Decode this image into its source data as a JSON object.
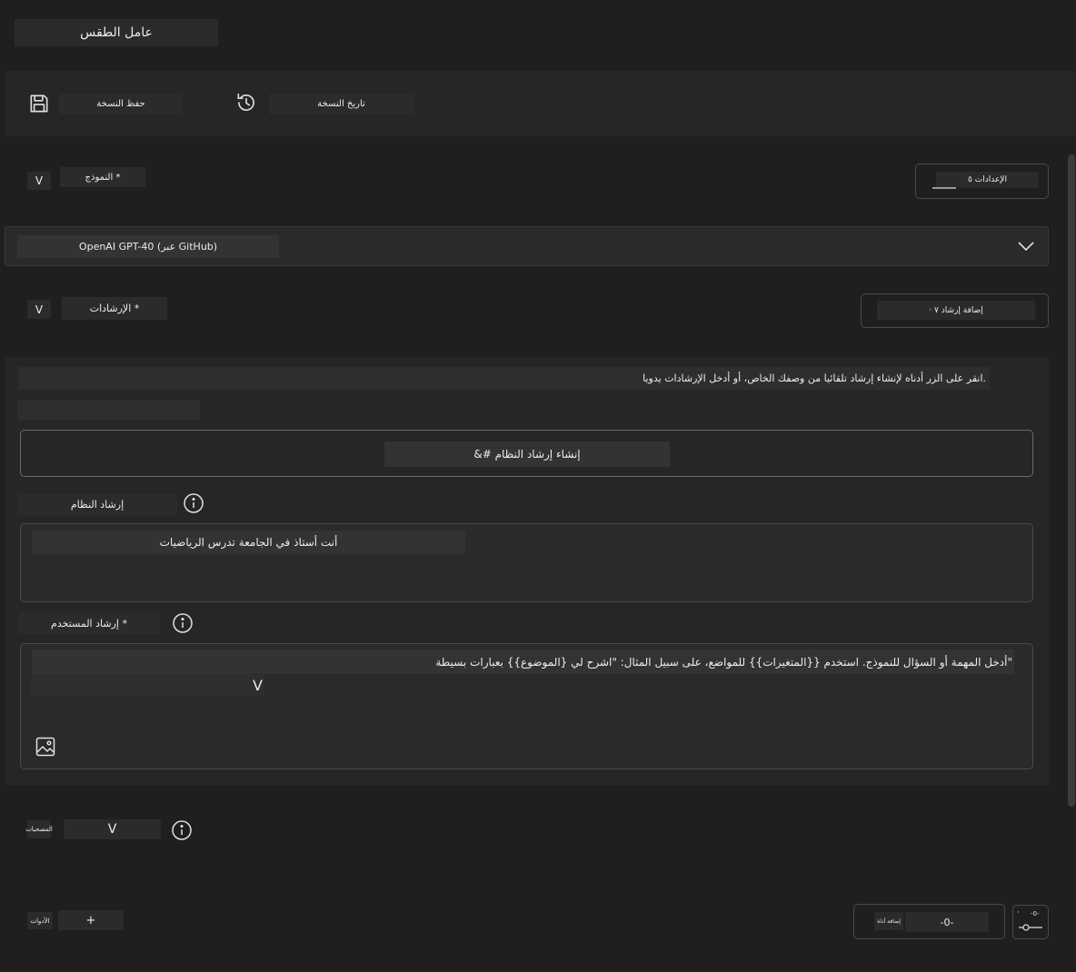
{
  "app": {
    "title": "عامل الطقس"
  },
  "toolbar": {
    "save_label": "حفظ النسخة",
    "history_label": "تاريخ النسخة"
  },
  "model": {
    "label": "النموذج *",
    "chevron": "V",
    "settings_label": "الإعدادات ٥",
    "selected": "OpenAI GPT-40 (عبر GitHub)"
  },
  "instructions": {
    "label": "الإرشادات *",
    "chevron": "V",
    "add_label": "· إضافة إرشاد ٧",
    "hint": "انقر على الزر أدناه لإنشاء إرشاد تلقائيا من وصفك الخاص، أو أدخل الإرشادات يدويا.",
    "generate_label": "&# إنشاء إرشاد النظام",
    "system_label": "إرشاد النظام",
    "system_value": "أنت أستاذ في الجامعة تدرس الرياضيات",
    "user_label": "إرشاد المستخدم *",
    "user_placeholder": "أدخل المهمة أو السؤال للنموذج. استخدم {{المتغيرات}} للمواضع، على سبيل المثال: \"اشرح لي {الموضوع}} بعبارات بسيطة\"",
    "user_chevron": "V"
  },
  "attachments": {
    "label": "المصحبات",
    "chevron": "V"
  },
  "tools": {
    "label": "الأدوات",
    "add_symbol": "+",
    "add_tool_label": "إضافة أداة",
    "add_tool_value": "-0-",
    "mini_value": "-0-",
    "mini_dot": "·"
  }
}
